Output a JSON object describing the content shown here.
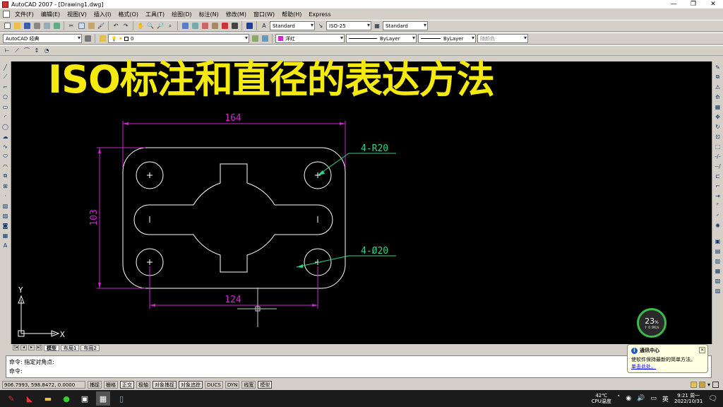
{
  "window": {
    "title": "AutoCAD 2007 - [Drawing1.dwg]",
    "controls": [
      "—",
      "❐",
      "✕"
    ]
  },
  "menu": [
    "文件(F)",
    "编辑(E)",
    "视图(V)",
    "插入(I)",
    "格式(O)",
    "工具(T)",
    "绘图(D)",
    "标注(N)",
    "修改(M)",
    "窗口(W)",
    "帮助(H)",
    "Express"
  ],
  "toolbar": {
    "text_style": "Standard",
    "dim_style": "ISO-25",
    "table_style": "Standard",
    "workspace": "AutoCAD 经典",
    "layer": "0",
    "color": "洋红",
    "linetype": "ByLayer",
    "lineweight": "ByLayer",
    "plotstyle": "随颜色"
  },
  "overlay_title": "ISO标注和直径的表达方法",
  "drawing": {
    "dim_top": "164",
    "dim_left": "103",
    "dim_bottom": "124",
    "leader_radius": "4-R20",
    "leader_diameter": "4-Ø20",
    "ucs_x": "X",
    "ucs_y": "Y"
  },
  "layout_tabs": [
    "模型",
    "布局1",
    "布局2"
  ],
  "command_lines": [
    "命令: 指定对角点:",
    "命令:"
  ],
  "status": {
    "coords": "906.7993, 598.8472, 0.0000",
    "toggles": [
      {
        "label": "捕捉",
        "on": false
      },
      {
        "label": "栅格",
        "on": false
      },
      {
        "label": "正交",
        "on": true
      },
      {
        "label": "极轴",
        "on": false
      },
      {
        "label": "对象捕捉",
        "on": true
      },
      {
        "label": "对象追踪",
        "on": true
      },
      {
        "label": "DUCS",
        "on": false
      },
      {
        "label": "DYN",
        "on": false
      },
      {
        "label": "线宽",
        "on": false
      },
      {
        "label": "模型",
        "on": true
      }
    ]
  },
  "notification": {
    "title": "通讯中心",
    "body": "使软件保持最新的简单方法。",
    "link": "单击此处。"
  },
  "gauge": {
    "percent": "23",
    "unit": "%",
    "speed": "↑ 0.9K/s"
  },
  "taskbar": {
    "temp": "42℃",
    "temp_label": "CPU温度",
    "ime": "英",
    "time": "9:21 周一",
    "date": "2022/10/31"
  },
  "colors": {
    "drawing_line": "#ffffff",
    "dimension": "#d126d1",
    "leader": "#2fd38a",
    "overlay": "#f5ea10",
    "crosshair": "#cccccc"
  }
}
